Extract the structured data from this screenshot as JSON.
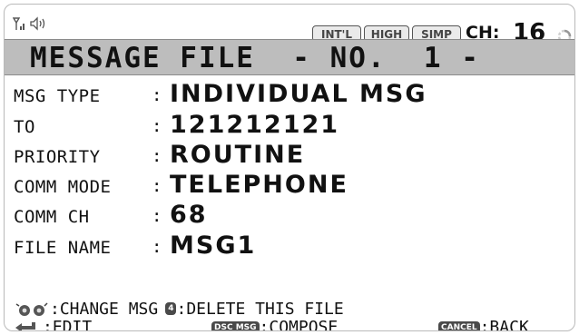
{
  "status_bar": {
    "badges": [
      "INT'L",
      "HIGH",
      "SIMP"
    ],
    "channel_label": "CH:",
    "channel_value": "16"
  },
  "title": "MESSAGE FILE  - NO.  1 -",
  "fields": [
    {
      "label": "MSG TYPE",
      "value": "INDIVIDUAL MSG"
    },
    {
      "label": "TO",
      "value": "121212121"
    },
    {
      "label": "PRIORITY",
      "value": "ROUTINE"
    },
    {
      "label": "COMM MODE",
      "value": "TELEPHONE"
    },
    {
      "label": "COMM CH",
      "value": "68"
    },
    {
      "label": "FILE NAME",
      "value": "MSG1"
    }
  ],
  "colon": ":",
  "footer": {
    "change_msg": ":CHANGE MSG",
    "key_4": "4",
    "delete_file": ":DELETE THIS FILE",
    "edit": ":EDIT",
    "dsc_msg_key": "DSC MSG",
    "compose": ":COMPOSE",
    "cancel_key": "CANCEL",
    "back": ":BACK"
  },
  "icons": [
    "signal-strength-icon",
    "speaker-icon",
    "busy-spinner-icon",
    "knob-rotate-icon",
    "enter-arrow-icon"
  ]
}
